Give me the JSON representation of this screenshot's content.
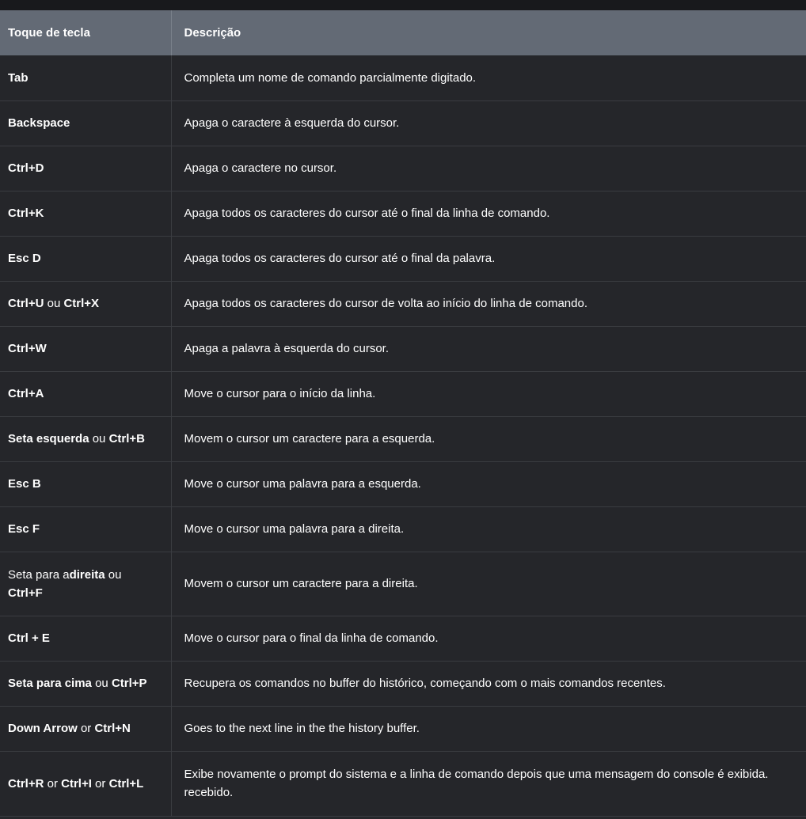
{
  "table": {
    "headers": [
      "Toque de tecla",
      "Descrição"
    ],
    "rows": [
      {
        "key": {
          "b1": "Tab"
        },
        "description": "Completa um nome de comando parcialmente digitado."
      },
      {
        "key": {
          "b1": "Backspace"
        },
        "description": "Apaga o caractere à esquerda do cursor."
      },
      {
        "key": {
          "b1": "Ctrl+D"
        },
        "description": "Apaga o caractere no cursor."
      },
      {
        "key": {
          "b1": "Ctrl+K"
        },
        "description": "Apaga todos os caracteres do cursor até o final da linha de comando."
      },
      {
        "key": {
          "b1": "Esc D"
        },
        "description": "Apaga todos os caracteres do cursor até o final da palavra."
      },
      {
        "key": {
          "b1": "Ctrl+U",
          "sep": " ou ",
          "b2": "Ctrl+X"
        },
        "description": "Apaga todos os caracteres do cursor de volta ao início do linha de comando."
      },
      {
        "key": {
          "b1": "Ctrl+W"
        },
        "description": "Apaga a palavra à esquerda do cursor."
      },
      {
        "key": {
          "b1": "Ctrl+A"
        },
        "description": "Move o cursor para o início da linha."
      },
      {
        "key": {
          "b1": "Seta esquerda",
          "sep": " ou ",
          "b2": "Ctrl+B"
        },
        "description": "Movem o cursor um caractere para a esquerda."
      },
      {
        "key": {
          "b1": "Esc B"
        },
        "description": "Move o cursor uma palavra para a esquerda."
      },
      {
        "key": {
          "b1": "Esc F"
        },
        "description": "Move o cursor uma palavra para a direita."
      },
      {
        "key": {
          "pre": "Seta para a",
          "b1": "direita",
          "sep": " ou ",
          "b2": "Ctrl+F"
        },
        "description": "Movem o cursor um caractere para a direita."
      },
      {
        "key": {
          "b1": "Ctrl + E"
        },
        "description": "Move o cursor para o final da linha de comando."
      },
      {
        "key": {
          "b1": "Seta para cima",
          "sep": " ou ",
          "b2": "Ctrl+P"
        },
        "description": "Recupera os comandos no buffer do histórico, começando com o mais comandos recentes."
      },
      {
        "key": {
          "b1": "Down Arrow",
          "sep": " or ",
          "b2": "Ctrl+N"
        },
        "description": "Goes to the next line in the the history buffer."
      },
      {
        "key": {
          "b1": "Ctrl+R",
          "sep": " or ",
          "b2": "Ctrl+I",
          "sep2": " or ",
          "b3": "Ctrl+L"
        },
        "description": "Exibe novamente o prompt do sistema e a linha de comando depois que uma mensagem do console é exibida. recebido."
      }
    ]
  }
}
